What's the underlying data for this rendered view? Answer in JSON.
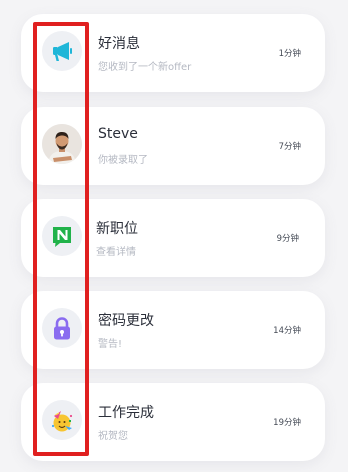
{
  "notifications": [
    {
      "icon": "megaphone-icon",
      "title": "好消息",
      "subtitle": "您收到了一个新offer",
      "time": "1分钟"
    },
    {
      "icon": "profile-photo",
      "title": "Steve",
      "subtitle": "你被录取了",
      "time": "7分钟"
    },
    {
      "icon": "new-n-icon",
      "title": "新职位",
      "subtitle": "查看详情",
      "time": "9分钟"
    },
    {
      "icon": "lock-icon",
      "title": "密码更改",
      "subtitle": "警告!",
      "time": "14分钟"
    },
    {
      "icon": "party-face-icon",
      "title": "工作完成",
      "subtitle": "祝贺您",
      "time": "19分钟"
    }
  ],
  "colors": {
    "page_background": "#f4f4f6",
    "card_background": "#ffffff",
    "highlight_border": "#e02020",
    "megaphone": "#1fb6d8",
    "new_badge": "#21b24a",
    "lock": "#8a6cf0"
  }
}
